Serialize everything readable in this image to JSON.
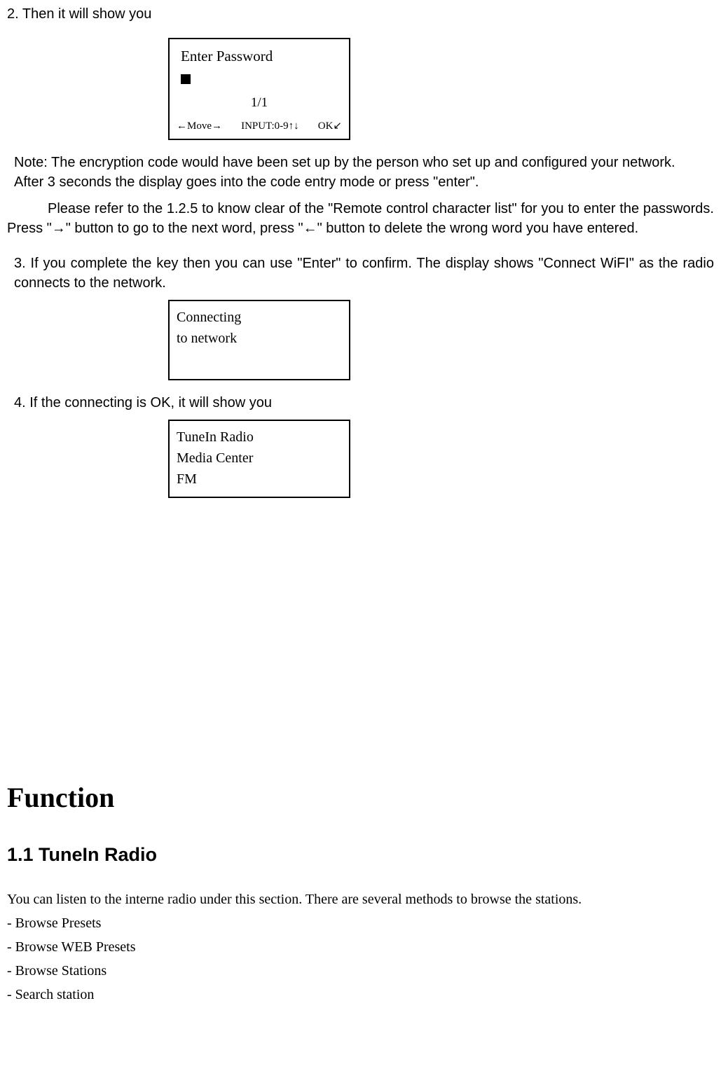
{
  "step2_intro": "2. Then it will show you",
  "password_screen": {
    "title": "Enter Password",
    "count": "1/1",
    "hint_move": "←Move→",
    "hint_input": "INPUT:0-9↑↓",
    "hint_ok": "OK↙"
  },
  "note_line1": "Note: The encryption code would have been set up by the person who set up and configured your network.",
  "note_line2": "After 3 seconds the display goes into the code entry mode or press \"enter\".",
  "instruction_para": "Please refer to the 1.2.5 to know clear of the \"Remote control character list\" for you to enter the passwords. Press \"→\" button to go to the next word, press \"←\" button to delete the wrong word you have entered.",
  "step3_text": "3. If you complete the key then you can use \"Enter\" to confirm. The display shows \"Connect WiFI\" as the radio connects to the network.",
  "connecting_screen": {
    "line1": "Connecting",
    "line2": "to network"
  },
  "step4_text": "4. If the connecting is OK, it will show you",
  "menu_screen": {
    "item1": "TuneIn Radio",
    "item2": "Media Center",
    "item3": "FM"
  },
  "function_heading": "Function",
  "tunein_heading": "1.1 TuneIn Radio",
  "tunein_desc": "You can listen to the interne radio under this section. There are several methods to browse the stations.",
  "browse_presets": "- Browse Presets",
  "browse_web_presets": "- Browse WEB Presets",
  "browse_stations": "- Browse Stations",
  "search_station": "- Search station"
}
